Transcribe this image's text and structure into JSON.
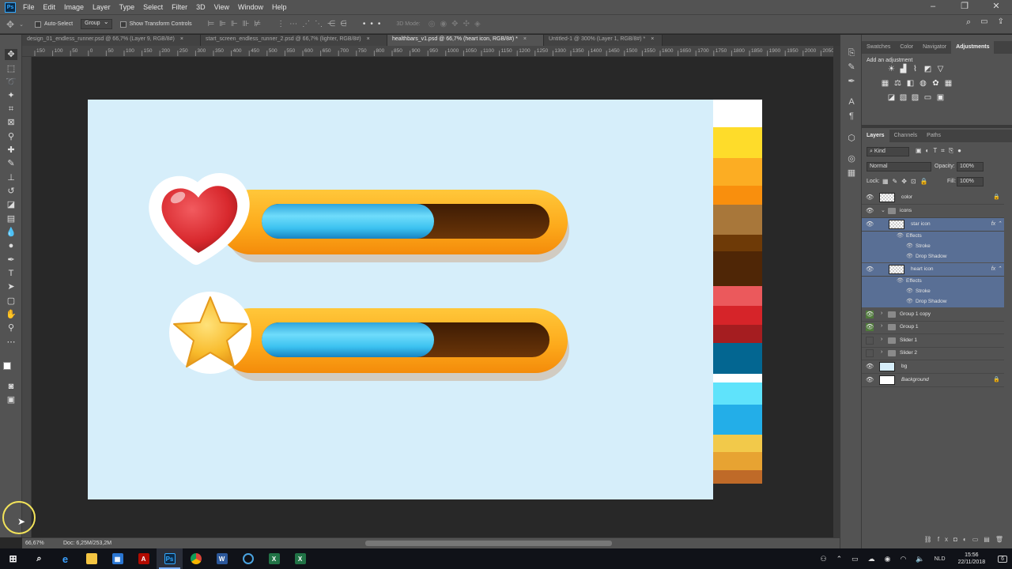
{
  "menu": [
    "File",
    "Edit",
    "Image",
    "Layer",
    "Type",
    "Select",
    "Filter",
    "3D",
    "View",
    "Window",
    "Help"
  ],
  "options": {
    "auto_select": "Auto-Select",
    "group_select": "Group",
    "show_transform": "Show Transform Controls",
    "mode_3d": "3D Mode:"
  },
  "tabs": [
    {
      "label": "design_01_endless_runner.psd @ 66,7% (Layer 9, RGB/8#)",
      "active": false
    },
    {
      "label": "start_screen_endless_runner_2.psd @ 66,7% (lighter, RGB/8#)",
      "active": false
    },
    {
      "label": "healthbars_v1.psd @ 66,7% (heart icon, RGB/8#) *",
      "active": true
    },
    {
      "label": "Untitled-1 @ 300% (Layer 1, RGB/8#) *",
      "active": false
    }
  ],
  "ruler_ticks": [
    "150",
    "100",
    "50",
    "0",
    "50",
    "100",
    "150",
    "200",
    "250",
    "300",
    "350",
    "400",
    "450",
    "500",
    "550",
    "600",
    "650",
    "700",
    "750",
    "800",
    "850",
    "900",
    "950",
    "1000",
    "1050",
    "1100",
    "1150",
    "1200",
    "1250",
    "1300",
    "1350",
    "1400",
    "1450",
    "1500",
    "1550",
    "1600",
    "1650",
    "1700",
    "1750",
    "1800",
    "1850",
    "1900",
    "1950",
    "2000",
    "2050"
  ],
  "health_bars": [
    {
      "icon": "heart",
      "fill": 0.6
    },
    {
      "icon": "star",
      "fill": 0.6
    }
  ],
  "palette_colors": [
    "#ffffff",
    "#fedc2a",
    "#fcad23",
    "#f98f0d",
    "#a8773a",
    "#6e3a07",
    "#4f2606",
    "#eb595c",
    "#d62429",
    "#a51d20",
    "#036691",
    "#ffffff",
    "#5fe3fb",
    "#23aee8",
    "#f2c94a",
    "#e7a332",
    "#bf6a28"
  ],
  "status": {
    "zoom": "66,67%",
    "doc": "Doc: 6,25M/253,2M"
  },
  "panels": {
    "top_tabs": [
      "Swatches",
      "Color",
      "Navigator",
      "Adjustments"
    ],
    "add_adjustment": "Add an adjustment",
    "layer_tabs": [
      "Layers",
      "Channels",
      "Paths"
    ],
    "kind": "Kind",
    "blend": "Normal",
    "opacity_label": "Opacity:",
    "opacity": "100%",
    "lock_label": "Lock:",
    "fill_label": "Fill:",
    "fill": "100%"
  },
  "layers": [
    {
      "name": "color",
      "type": "layer",
      "visible": true,
      "locked": true
    },
    {
      "name": "icons",
      "type": "group",
      "visible": true,
      "open": true
    },
    {
      "name": "star icon",
      "type": "layer",
      "visible": true,
      "fx": true,
      "selected": true
    },
    {
      "name": "Effects",
      "type": "effect-head",
      "selected": true
    },
    {
      "name": "Stroke",
      "type": "effect",
      "selected": true
    },
    {
      "name": "Drop Shadow",
      "type": "effect",
      "selected": true
    },
    {
      "name": "heart icon",
      "type": "layer",
      "visible": true,
      "fx": true,
      "selected": true
    },
    {
      "name": "Effects",
      "type": "effect-head",
      "selected": true
    },
    {
      "name": "Stroke",
      "type": "effect",
      "selected": true
    },
    {
      "name": "Drop Shadow",
      "type": "effect",
      "selected": true
    },
    {
      "name": "Group 1 copy",
      "type": "group",
      "visible": true,
      "color": "green"
    },
    {
      "name": "Group 1",
      "type": "group",
      "visible": true,
      "color": "green"
    },
    {
      "name": "Slider 1",
      "type": "group",
      "visible": false
    },
    {
      "name": "Slider 2",
      "type": "group",
      "visible": false
    },
    {
      "name": "bg",
      "type": "layer",
      "visible": true
    },
    {
      "name": "Background",
      "type": "layer",
      "visible": true,
      "locked": true,
      "italic": true
    }
  ],
  "taskbar": {
    "time": "15:56",
    "date": "22/11/2018",
    "lang": "NLD",
    "notif": "6"
  }
}
